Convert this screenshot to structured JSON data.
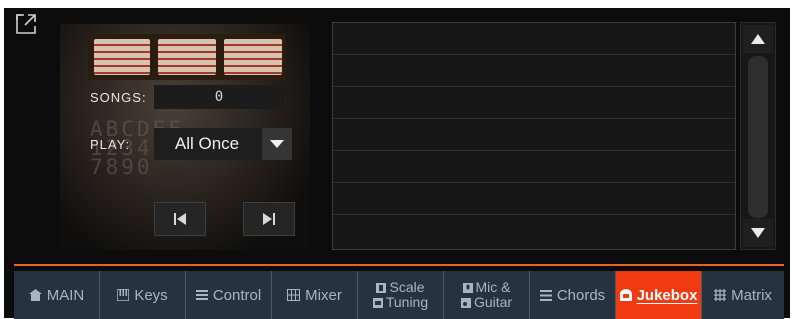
{
  "expand_icon": "expand-icon",
  "player": {
    "songs_label": "SONGS:",
    "songs_value": "0",
    "play_label": "PLAY:",
    "play_mode": "All Once",
    "prev_icon": "skip-previous-icon",
    "next_icon": "skip-next-icon"
  },
  "song_list": {
    "rows": [
      "",
      "",
      "",
      "",
      "",
      "",
      ""
    ]
  },
  "tabs": [
    {
      "icon": "home-icon",
      "label": "MAIN"
    },
    {
      "icon": "keys-icon",
      "label": "Keys"
    },
    {
      "icon": "control-icon",
      "label": "Control"
    },
    {
      "icon": "mixer-icon",
      "label": "Mixer"
    },
    {
      "icon": "scale-icon",
      "label": "Scale",
      "icon2": "tuning-icon",
      "label2": "Tuning"
    },
    {
      "icon": "mic-icon",
      "label": "Mic &",
      "icon2": "guitar-icon",
      "label2": "Guitar"
    },
    {
      "icon": "chords-icon",
      "label": "Chords"
    },
    {
      "icon": "jukebox-icon",
      "label": "Jukebox",
      "active": true
    },
    {
      "icon": "matrix-icon",
      "label": "Matrix"
    }
  ],
  "colors": {
    "accent": "#e8642a",
    "active_tab": "#f03a12",
    "tab_bg": "#26333f",
    "panel_bg": "#0c0c0c"
  }
}
